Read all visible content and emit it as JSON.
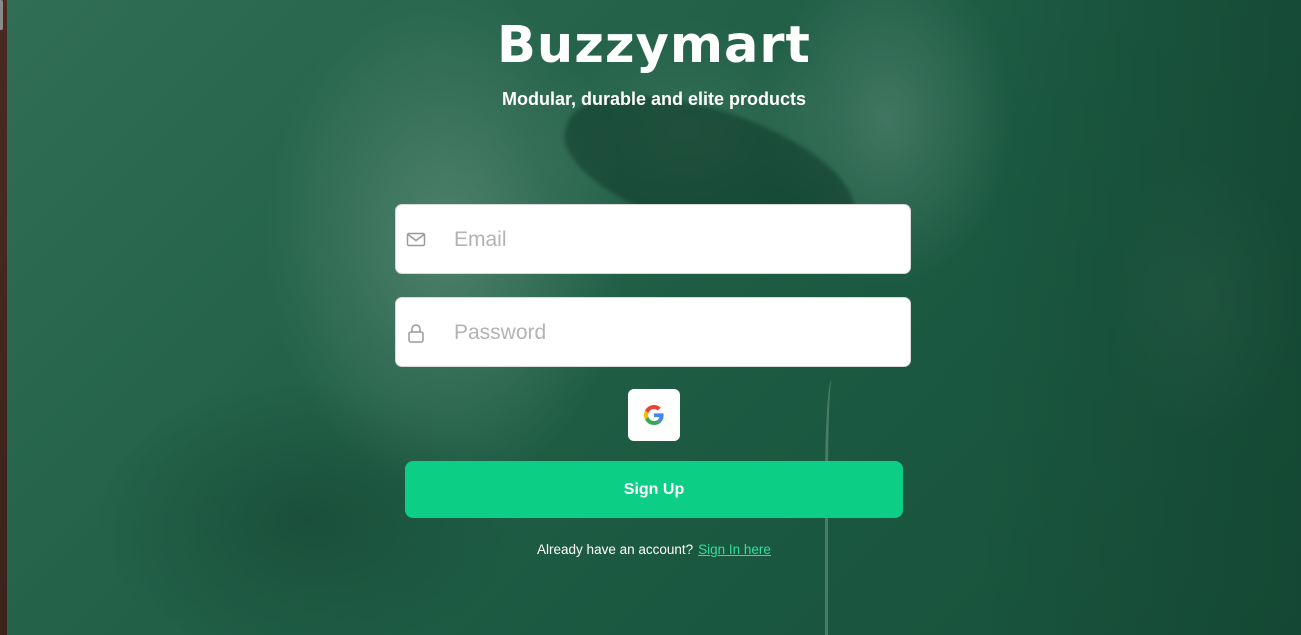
{
  "brand": {
    "title": "Buzzymart",
    "tagline": "Modular, durable and elite products"
  },
  "form": {
    "email": {
      "placeholder": "Email",
      "value": "",
      "icon": "mail-icon"
    },
    "password": {
      "placeholder": "Password",
      "value": "",
      "icon": "lock-icon"
    },
    "google_button": {
      "icon": "google-icon"
    },
    "submit_label": "Sign Up"
  },
  "footer": {
    "prompt": "Already have an account?",
    "link_label": "Sign In here"
  },
  "colors": {
    "accent": "#0ccf85",
    "link": "#2fe09a",
    "overlay": "#16583e"
  }
}
